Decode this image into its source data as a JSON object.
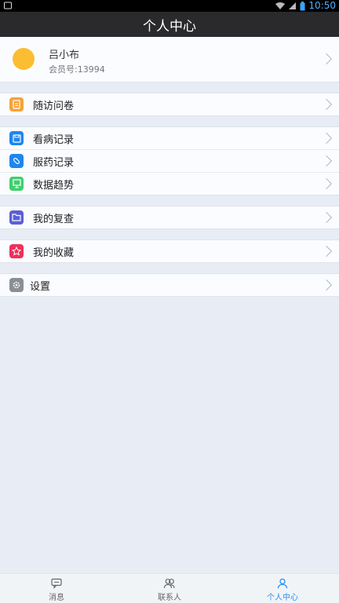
{
  "status_bar": {
    "time": "10:50"
  },
  "header": {
    "title": "个人中心"
  },
  "profile": {
    "name": "吕小布",
    "member_id": "会员号:13994",
    "avatar_color": "#fbbd31"
  },
  "sections": [
    {
      "items": [
        {
          "label": "随访问卷",
          "icon": "document-icon",
          "color": "#f7a23a"
        }
      ]
    },
    {
      "items": [
        {
          "label": "看病记录",
          "icon": "save-icon",
          "color": "#1f86ef"
        },
        {
          "label": "服药记录",
          "icon": "pill-icon",
          "color": "#1f86ef"
        },
        {
          "label": "数据趋势",
          "icon": "chart-board-icon",
          "color": "#3fcf6e"
        }
      ]
    },
    {
      "items": [
        {
          "label": "我的复查",
          "icon": "folder-icon",
          "color": "#5a5fd6"
        }
      ]
    },
    {
      "items": [
        {
          "label": "我的收藏",
          "icon": "star-icon",
          "color": "#f0305a"
        }
      ]
    },
    {
      "items": [
        {
          "label": "设置",
          "icon": "gear-icon",
          "color": "#8a8f96"
        }
      ]
    }
  ],
  "tabs": [
    {
      "label": "消息",
      "icon": "message-icon",
      "active": false
    },
    {
      "label": "联系人",
      "icon": "contacts-icon",
      "active": false
    },
    {
      "label": "个人中心",
      "icon": "person-icon",
      "active": true
    }
  ]
}
